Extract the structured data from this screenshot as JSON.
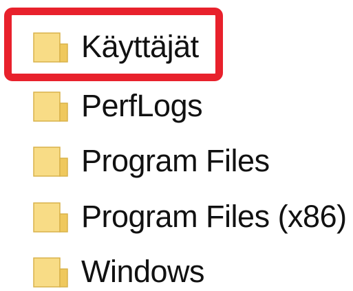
{
  "folders": [
    {
      "label": "Käyttäjät",
      "icon": "folder-icon",
      "highlighted": true
    },
    {
      "label": "PerfLogs",
      "icon": "folder-icon",
      "highlighted": false
    },
    {
      "label": "Program Files",
      "icon": "folder-icon",
      "highlighted": false
    },
    {
      "label": "Program Files (x86)",
      "icon": "folder-icon",
      "highlighted": false
    },
    {
      "label": "Windows",
      "icon": "folder-icon",
      "highlighted": false
    }
  ],
  "colors": {
    "highlight_border": "#e8212c",
    "folder_fill": "#f8dc86",
    "folder_edge": "#d9b24a",
    "text": "#111111"
  }
}
